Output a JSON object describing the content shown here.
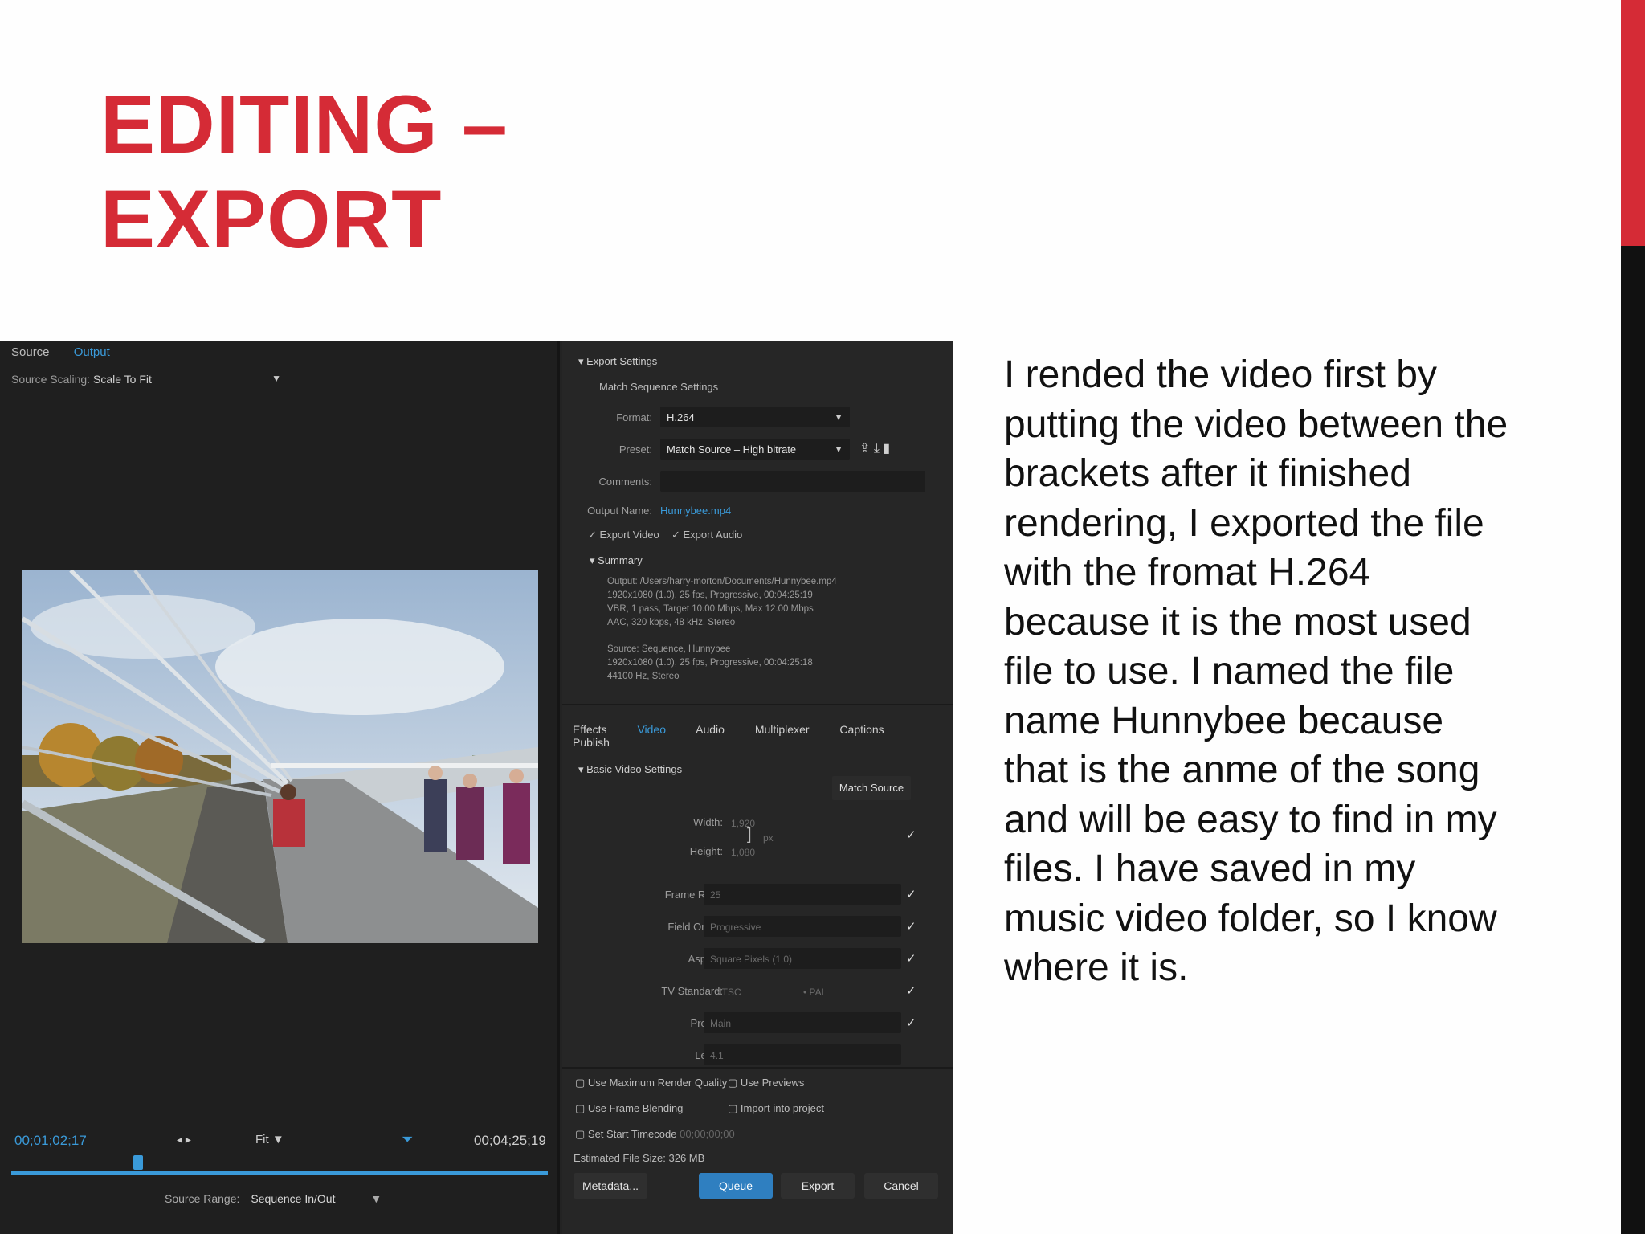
{
  "slide": {
    "title_line1": "EDITING –",
    "title_line2": "EXPORT",
    "body": "I rended the video first by putting the video between the brackets after it finished rendering, I exported the file with the fromat H.264 because it is the most used file to use. I named the file name Hunnybee because that is the anme of the song and will be easy to find in my files. I have saved in my music video folder, so I know where it is.",
    "colors": {
      "accent": "#d52b36",
      "dark": "#111111"
    }
  },
  "export_dialog": {
    "tabs": [
      "Source",
      "Output"
    ],
    "source_scaling_label": "Source Scaling:",
    "source_scaling_value": "Scale To Fit",
    "timecode_current": "00;01;02;17",
    "timecode_end": "00;04;25;19",
    "fit_label": "Fit",
    "source_range_label": "Source Range:",
    "source_range_value": "Sequence In/Out",
    "export_settings_header": "Export Settings",
    "match_sequence_label": "Match Sequence Settings",
    "format_label": "Format:",
    "format_value": "H.264",
    "preset_label": "Preset:",
    "preset_value": "Match Source – High bitrate",
    "comments_label": "Comments:",
    "output_name_label": "Output Name:",
    "output_name_value": "Hunnybee.mp4",
    "export_video_label": "✓ Export Video",
    "export_audio_label": "✓ Export Audio",
    "summary_header": "Summary",
    "summary_output": "Output: /Users/harry-morton/Documents/Hunnybee.mp4\n1920x1080 (1.0), 25 fps, Progressive, 00:04:25:19\nVBR, 1 pass, Target 10.00 Mbps, Max 12.00 Mbps\nAAC, 320 kbps, 48 kHz, Stereo",
    "summary_source": "Source: Sequence, Hunnybee\n1920x1080 (1.0), 25 fps, Progressive, 00:04:25:18\n44100 Hz, Stereo",
    "section_tabs": [
      "Effects",
      "Video",
      "Audio",
      "Multiplexer",
      "Captions",
      "Publish"
    ],
    "basic_video_header": "Basic Video Settings",
    "match_source_button": "Match Source",
    "fields": [
      {
        "label": "Width:",
        "value": "1,920"
      },
      {
        "label": "Height:",
        "value": "1,080"
      },
      {
        "label": "Frame Rate:",
        "value": "25"
      },
      {
        "label": "Field Order:",
        "value": "Progressive"
      },
      {
        "label": "Aspect:",
        "value": "Square Pixels (1.0)"
      },
      {
        "label": "TV Standard:",
        "value": "NTSC"
      },
      {
        "label": "Profile:",
        "value": "Main"
      },
      {
        "label": "Level:",
        "value": "4.1"
      }
    ],
    "pal_label": "PAL",
    "px_label": "px",
    "use_max_render": "Use Maximum Render Quality",
    "use_previews": "Use Previews",
    "use_frame_blending": "Use Frame Blending",
    "import_into_project": "Import into project",
    "set_start_timecode": "Set Start Timecode",
    "start_timecode_value": "00;00;00;00",
    "estimated_size": "Estimated File Size: 326 MB",
    "buttons": {
      "metadata": "Metadata...",
      "queue": "Queue",
      "export": "Export",
      "cancel": "Cancel"
    }
  }
}
